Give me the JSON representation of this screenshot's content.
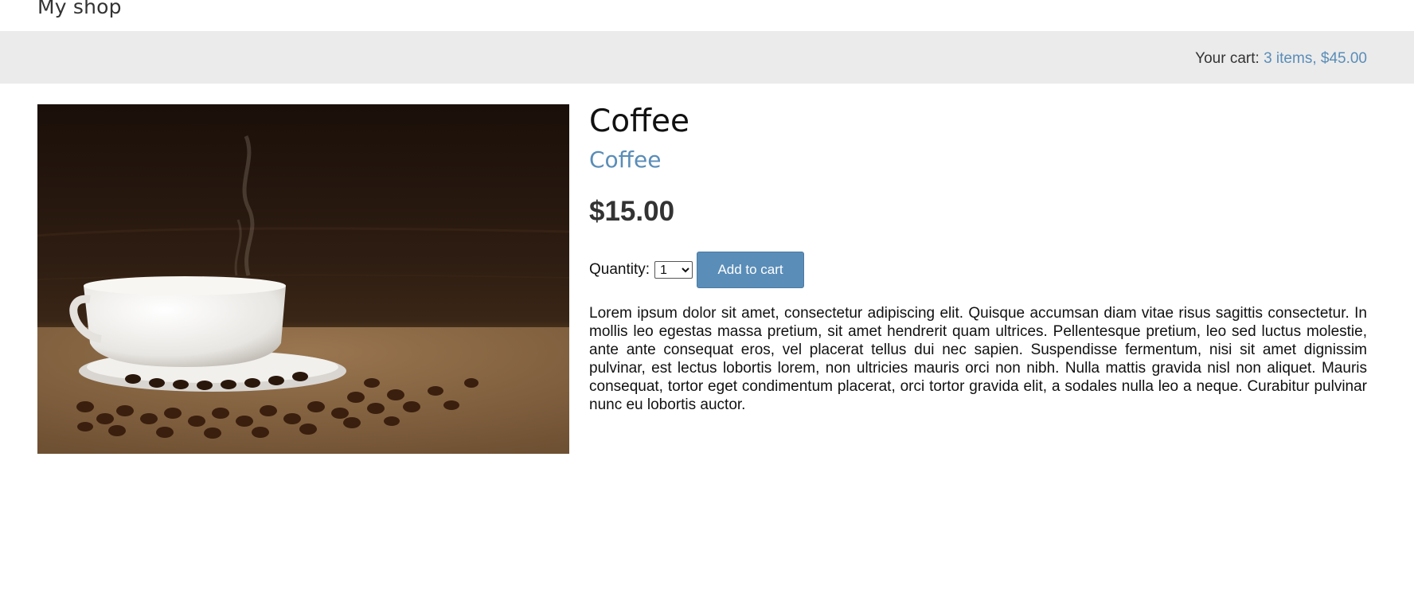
{
  "header": {
    "shop_title": "My shop"
  },
  "cart": {
    "label": "Your cart:",
    "summary": "3 items, $45.00"
  },
  "product": {
    "image_alt": "Coffee",
    "name": "Coffee",
    "category": "Coffee",
    "price": "$15.00",
    "quantity_label": "Quantity:",
    "quantity_value": "1",
    "add_to_cart_label": "Add to cart",
    "description": "Lorem ipsum dolor sit amet, consectetur adipiscing elit. Quisque accumsan diam vitae risus sagittis consectetur. In mollis leo egestas massa pretium, sit amet hendrerit quam ultrices. Pellentesque pretium, leo sed luctus molestie, ante ante consequat eros, vel placerat tellus dui nec sapien. Suspendisse fermentum, nisi sit amet dignissim pulvinar, est lectus lobortis lorem, non ultricies mauris orci non nibh. Nulla mattis gravida nisl non aliquet. Mauris consequat, tortor eget condimentum placerat, orci tortor gravida elit, a sodales nulla leo a neque. Curabitur pulvinar nunc eu lobortis auctor."
  },
  "colors": {
    "accent": "#5a8db8",
    "cart_bar_bg": "#ebebeb",
    "text": "#333333"
  }
}
